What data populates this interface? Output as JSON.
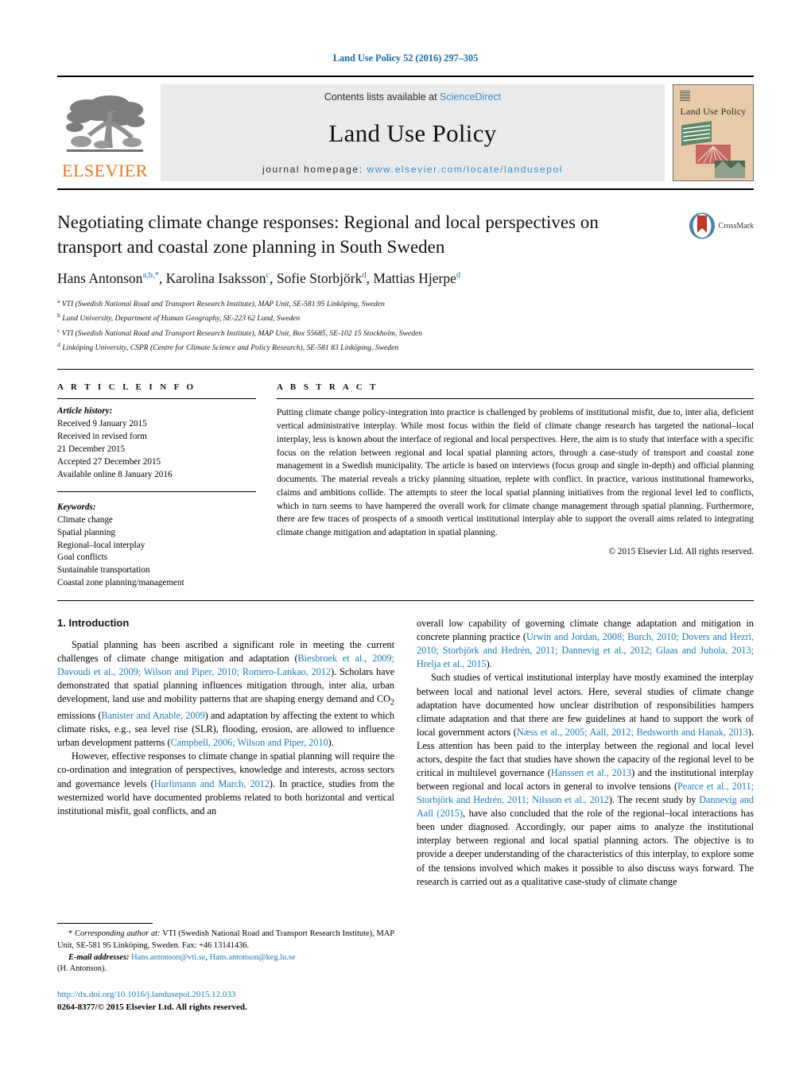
{
  "running_head": "Land Use Policy 52 (2016) 297–305",
  "masthead": {
    "publisher_name": "ELSEVIER",
    "contents_prefix": "Contents lists available at ",
    "contents_link": "ScienceDirect",
    "journal_name": "Land Use Policy",
    "homepage_prefix": "journal homepage: ",
    "homepage_url": "www.elsevier.com/locate/landusepol",
    "cover_title": "Land Use Policy"
  },
  "article": {
    "title": "Negotiating climate change responses: Regional and local perspectives on transport and coastal zone planning in South Sweden",
    "authors_html": "Hans Antonson<sup>a,b,</sup><sup>*</sup>, Karolina Isaksson<sup>c</sup>, Sofie Storbjörk<sup>d</sup>, Mattias Hjerpe<sup>d</sup>",
    "crossmark_label": "CrossMark",
    "affiliations": [
      "VTI (Swedish National Road and Transport Research Institute), MAP Unit, SE-581 95 Linköping, Sweden",
      "Lund University, Department of Human Geography, SE-223 62 Lund, Sweden",
      "VTI (Swedish National Road and Transport Research Institute), MAP Unit, Box 55685, SE-102 15 Stockholm, Sweden",
      "Linköping University, CSPR (Centre for Climate Science and Policy Research), SE-581 83 Linköping, Sweden"
    ],
    "affiliation_markers": [
      "a",
      "b",
      "c",
      "d"
    ]
  },
  "article_info": {
    "heading": "A R T I C L E   I N F O",
    "history_label": "Article history:",
    "history": [
      "Received 9 January 2015",
      "Received in revised form",
      "21 December 2015",
      "Accepted 27 December 2015",
      "Available online 8 January 2016"
    ],
    "keywords_label": "Keywords:",
    "keywords": [
      "Climate change",
      "Spatial planning",
      "Regional–local interplay",
      "Goal conflicts",
      "Sustainable transportation",
      "Coastal zone planning/management"
    ]
  },
  "abstract": {
    "heading": "A B S T R A C T",
    "text": "Putting climate change policy-integration into practice is challenged by problems of institutional misfit, due to, inter alia, deficient vertical administrative interplay. While most focus within the field of climate change research has targeted the national–local interplay, less is known about the interface of regional and local perspectives. Here, the aim is to study that interface with a specific focus on the relation between regional and local spatial planning actors, through a case-study of transport and coastal zone management in a Swedish municipality. The article is based on interviews (focus group and single in-depth) and official planning documents. The material reveals a tricky planning situation, replete with conflict. In practice, various institutional frameworks, claims and ambitions collide. The attempts to steer the local spatial planning initiatives from the regional level led to conflicts, which in turn seems to have hampered the overall work for climate change management through spatial planning. Furthermore, there are few traces of prospects of a smooth vertical institutional interplay able to support the overall aims related to integrating climate change mitigation and adaptation in spatial planning.",
    "copyright": "© 2015 Elsevier Ltd. All rights reserved."
  },
  "introduction": {
    "section_number_title": "1.  Introduction",
    "left_paragraphs_html": [
      "Spatial planning has been ascribed a significant role in meeting the current challenges of climate change mitigation and adaptation (<span class=\"cite\">Biesbroek et al., 2009; Davoudi et al., 2009; Wilson and Piper, 2010; Romero-Lankao, 2012</span>). Scholars have demonstrated that spatial planning influences mitigation through, inter alia, urban development, land use and mobility patterns that are shaping energy demand and CO<sub>2</sub> emissions (<span class=\"cite\">Banister and Anable, 2009</span>) and adaptation by affecting the extent to which climate risks, e.g., sea level rise (SLR), flooding, erosion, are allowed to influence urban development patterns (<span class=\"cite\">Campbell, 2006; Wilson and Piper, 2010</span>).",
      "However, effective responses to climate change in spatial planning will require the co-ordination and integration of perspectives, knowledge and interests, across sectors and governance levels (<span class=\"cite\">Hurlimann and March, 2012</span>). In practice, studies from the westernized world have documented problems related to both horizontal and vertical institutional misfit, goal conflicts, and an"
    ],
    "right_paragraphs_html": [
      "overall low capability of governing climate change adaptation and mitigation in concrete planning practice (<span class=\"cite\">Urwin and Jordan, 2008; Burch, 2010; Dovers and Hezri, 2010; Storbjörk and Hedrén, 2011; Dannevig et al., 2012; Glaas and Juhola, 2013; Hrelja et al., 2015</span>).",
      "Such studies of vertical institutional interplay have mostly examined the interplay between local and national level actors. Here, several studies of climate change adaptation have documented how unclear distribution of responsibilities hampers climate adaptation and that there are few guidelines at hand to support the work of local government actors (<span class=\"cite\">Næss et al., 2005; Aall, 2012; Bedsworth and Hanak, 2013</span>). Less attention has been paid to the interplay between the regional and local level actors, despite the fact that studies have shown the capacity of the regional level to be critical in multilevel governance (<span class=\"cite\">Hanssen et al., 2013</span>) and the institutional interplay between regional and local actors in general to involve tensions (<span class=\"cite\">Pearce et al., 2011; Storbjörk and Hedrén, 2011; Nilsson et al., 2012</span>). The recent study by <span class=\"cite\">Dannevig and Aall (2015)</span>, have also concluded that the role of the regional–local interactions has been under diagnosed. Accordingly, our paper aims to analyze the institutional interplay between regional and local spatial planning actors. The objective is to provide a deeper understanding of the characteristics of this interplay, to explore some of the tensions involved which makes it possible to also discuss ways forward. The research is carried out as a qualitative case-study of climate change"
    ]
  },
  "footnotes": {
    "corresponding_html": "<span class=\"lead\">* <em>Corresponding author at:</em> VTI (Swedish National Road and Transport Research Institute), MAP Unit, SE-581 95 Linköping, Sweden. Fax: +46 13141436.</span>",
    "email_label": "E-mail addresses:",
    "emails": [
      "Hans.antonson@vti.se",
      "Hans.antonson@keg.lu.se"
    ],
    "email_owner": "(H. Antonson).",
    "doi": "http://dx.doi.org/10.1016/j.landusepol.2015.12.033",
    "issn_line": "0264-8377/© 2015 Elsevier Ltd. All rights reserved."
  },
  "colors": {
    "link_blue": "#1a7cb8",
    "header_blue": "#1a6ea8",
    "elsevier_orange": "#e87722",
    "masthead_grey": "#e8eaec",
    "cover_tan": "#e8c9a8"
  }
}
